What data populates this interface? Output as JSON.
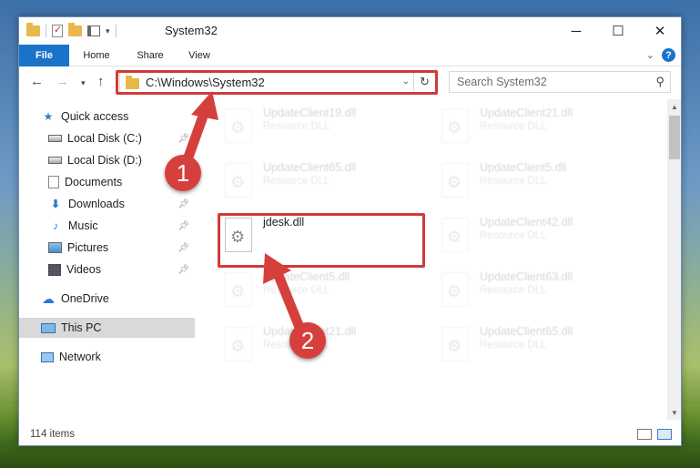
{
  "window": {
    "title": "System32",
    "controls": {
      "minimize": "─",
      "maximize": "☐",
      "close": "✕"
    }
  },
  "ribbon": {
    "tabs": [
      "File",
      "Home",
      "Share",
      "View"
    ]
  },
  "navbar": {
    "address": "C:\\Windows\\System32",
    "search_placeholder": "Search System32"
  },
  "sidebar": {
    "items": [
      {
        "label": "Quick access",
        "icon": "star-icon"
      },
      {
        "label": "Local Disk (C:)",
        "icon": "drive-icon",
        "pinned": true
      },
      {
        "label": "Local Disk (D:)",
        "icon": "drive-icon",
        "pinned": false
      },
      {
        "label": "Documents",
        "icon": "documents-icon",
        "pinned": true
      },
      {
        "label": "Downloads",
        "icon": "downloads-icon",
        "pinned": true
      },
      {
        "label": "Music",
        "icon": "music-icon",
        "pinned": true
      },
      {
        "label": "Pictures",
        "icon": "pictures-icon",
        "pinned": true
      },
      {
        "label": "Videos",
        "icon": "videos-icon",
        "pinned": true
      },
      {
        "label": "OneDrive",
        "icon": "onedrive-icon"
      },
      {
        "label": "This PC",
        "icon": "this-pc-icon",
        "selected": true
      },
      {
        "label": "Network",
        "icon": "network-icon"
      }
    ]
  },
  "files": [
    {
      "name": "UpdateClient19.dll",
      "type": "Resource DLL"
    },
    {
      "name": "UpdateClient21.dll",
      "type": "Resource DLL"
    },
    {
      "name": "UpdateClient65.dll",
      "type": "Resource DLL"
    },
    {
      "name": "UpdateClient5.dll",
      "type": "Resource DLL"
    },
    {
      "name": "jdesk.dll",
      "type": ""
    },
    {
      "name": "UpdateClient42.dll",
      "type": "Resource DLL"
    },
    {
      "name": "UpdateClient5.dll",
      "type": "Resource DLL"
    },
    {
      "name": "UpdateClient63.dll",
      "type": "Resource DLL"
    },
    {
      "name": "UpdateClient21.dll",
      "type": "Resource DLL"
    },
    {
      "name": "UpdateClient65.dll",
      "type": "Resource DLL"
    }
  ],
  "status": {
    "item_count": "114 items"
  },
  "annotations": {
    "badge1": "1",
    "badge2": "2",
    "color": "#d13a3a"
  }
}
